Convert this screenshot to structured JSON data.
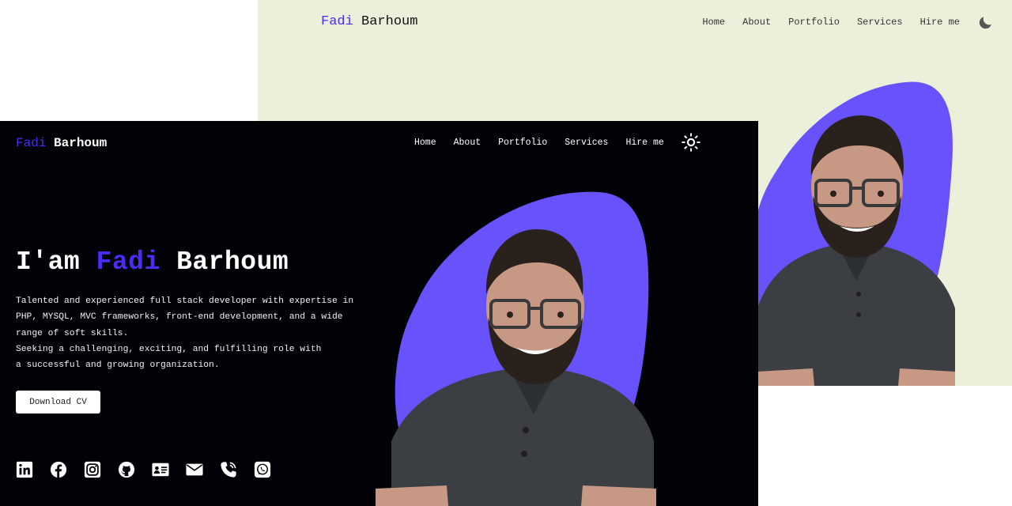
{
  "light": {
    "brand": {
      "first": "Fadi",
      "last": "Barhoum"
    },
    "nav": [
      "Home",
      "About",
      "Portfolio",
      "Services",
      "Hire me"
    ],
    "theme_toggle_icon": "moon-icon",
    "colors": {
      "background": "#ecf0db",
      "accent": "#6852fb"
    }
  },
  "dark": {
    "brand": {
      "first": "Fadi",
      "last": "Barhoum"
    },
    "nav": [
      "Home",
      "About",
      "Portfolio",
      "Services",
      "Hire me"
    ],
    "theme_toggle_icon": "sun-icon",
    "hero": {
      "greeting": "I'am",
      "first": "Fadi",
      "last": "Barhoum",
      "description_lines": [
        "Talented and experienced full stack developer with expertise in",
        "PHP, MYSQL, MVC frameworks, front-end development, and a wide",
        "range of soft skills.",
        "Seeking a challenging, exciting, and fulfilling role with",
        "a successful and growing organization."
      ],
      "cv_button": "Download CV"
    },
    "socials": [
      "linkedin-icon",
      "facebook-icon",
      "instagram-icon",
      "github-icon",
      "contact-card-icon",
      "email-icon",
      "phone-icon",
      "whatsapp-icon"
    ],
    "colors": {
      "background": "#020106",
      "accent": "#4a2df5",
      "blob": "#6852fb"
    }
  }
}
